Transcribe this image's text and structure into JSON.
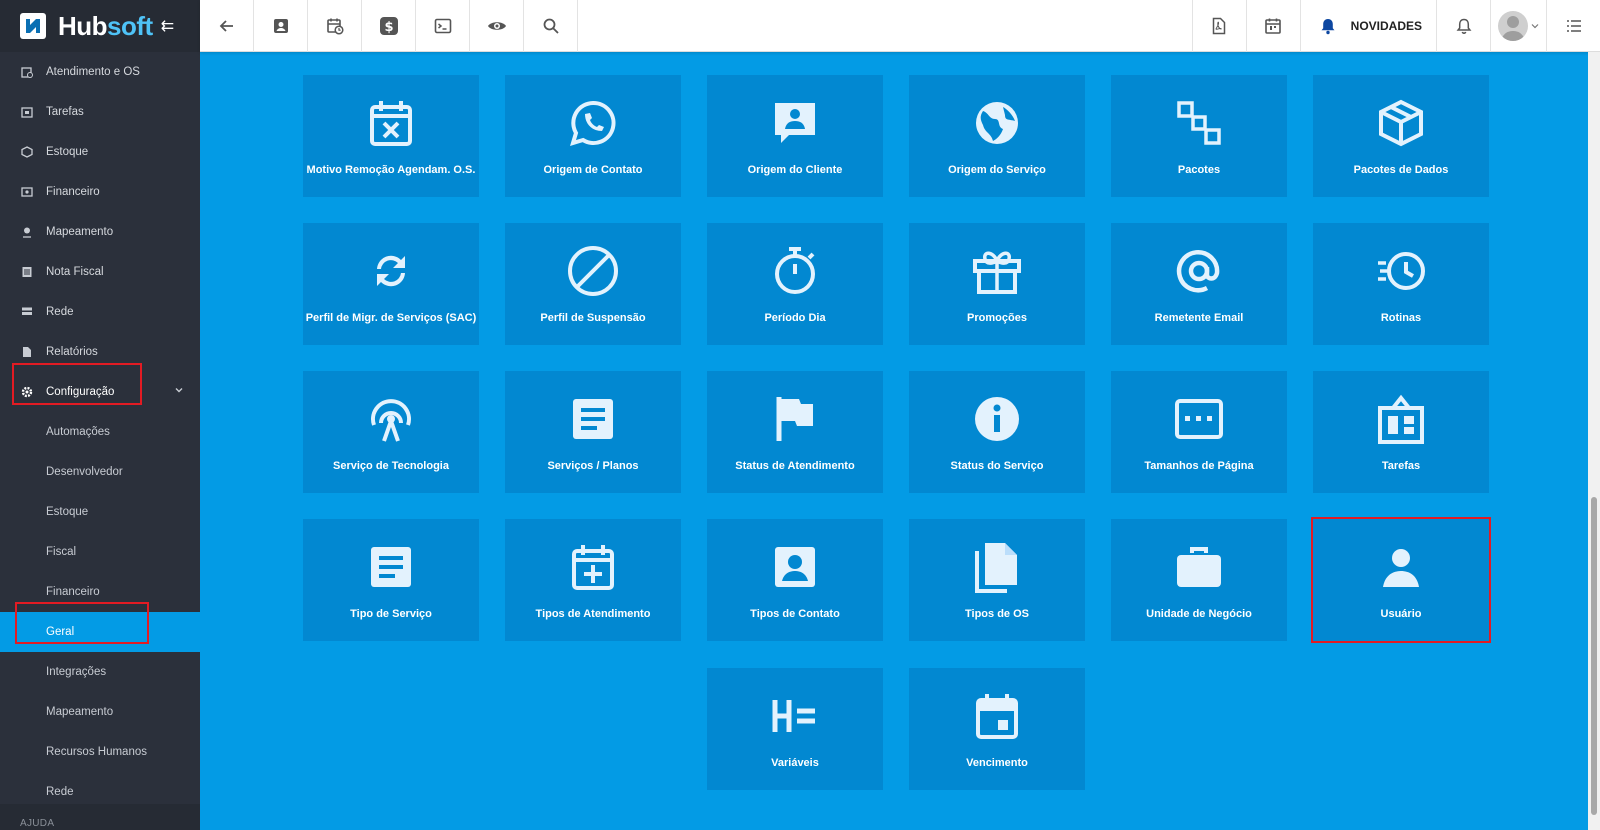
{
  "brand": {
    "part1": "Hub",
    "part2": "soft"
  },
  "colors": {
    "accent": "#039be5",
    "tile": "#0288d1",
    "sidebar": "#2b303b",
    "highlight": "#e31b23"
  },
  "sidebar": {
    "items": [
      {
        "label": "Atendimento e OS",
        "icon": "calendar-clock-icon"
      },
      {
        "label": "Tarefas",
        "icon": "building-icon"
      },
      {
        "label": "Estoque",
        "icon": "cube-icon"
      },
      {
        "label": "Financeiro",
        "icon": "money-icon"
      },
      {
        "label": "Mapeamento",
        "icon": "map-pin-icon"
      },
      {
        "label": "Nota Fiscal",
        "icon": "document-icon"
      },
      {
        "label": "Rede",
        "icon": "server-icon"
      },
      {
        "label": "Relatórios",
        "icon": "report-icon"
      },
      {
        "label": "Configuração",
        "icon": "gear-icon"
      }
    ],
    "submenu": [
      "Automações",
      "Desenvolvedor",
      "Estoque",
      "Fiscal",
      "Financeiro",
      "Geral",
      "Integrações",
      "Mapeamento",
      "Recursos Humanos",
      "Rede"
    ],
    "active_sub": "Geral",
    "section": "AJUDA"
  },
  "topbar": {
    "news_label": "NOVIDADES",
    "left_icons": [
      "back-arrow-icon",
      "contact-card-icon",
      "calendar-clock-icon",
      "dollar-icon",
      "terminal-icon",
      "eye-icon",
      "search-icon"
    ],
    "right_icons": [
      "pdf-icon",
      "calendar-building-icon",
      "bell-news-icon",
      "bell-icon",
      "avatar",
      "menu-list-icon"
    ]
  },
  "tiles": [
    {
      "label": "Motivo Remoção Agendam. O.S.",
      "icon": "calendar-x-icon"
    },
    {
      "label": "Origem de Contato",
      "icon": "whatsapp-icon"
    },
    {
      "label": "Origem do Cliente",
      "icon": "chat-person-icon"
    },
    {
      "label": "Origem do Serviço",
      "icon": "globe-icon"
    },
    {
      "label": "Pacotes",
      "icon": "squares-icon"
    },
    {
      "label": "Pacotes de Dados",
      "icon": "box-icon"
    },
    {
      "label": "Perfil de Migr. de Serviços (SAC)",
      "icon": "sync-icon"
    },
    {
      "label": "Perfil de Suspensão",
      "icon": "block-icon"
    },
    {
      "label": "Período Dia",
      "icon": "stopwatch-icon"
    },
    {
      "label": "Promoções",
      "icon": "gift-icon"
    },
    {
      "label": "Remetente Email",
      "icon": "at-icon"
    },
    {
      "label": "Rotinas",
      "icon": "history-icon"
    },
    {
      "label": "Serviço de Tecnologia",
      "icon": "antenna-icon"
    },
    {
      "label": "Serviços / Planos",
      "icon": "article-icon"
    },
    {
      "label": "Status de Atendimento",
      "icon": "flag-icon"
    },
    {
      "label": "Status do Serviço",
      "icon": "info-icon"
    },
    {
      "label": "Tamanhos de Página",
      "icon": "dots-frame-icon"
    },
    {
      "label": "Tarefas",
      "icon": "dashboard-box-icon"
    },
    {
      "label": "Tipo de Serviço",
      "icon": "article-icon"
    },
    {
      "label": "Tipos de Atendimento",
      "icon": "calendar-plus-icon"
    },
    {
      "label": "Tipos de Contato",
      "icon": "contact-box-icon"
    },
    {
      "label": "Tipos de OS",
      "icon": "files-icon"
    },
    {
      "label": "Unidade de Negócio",
      "icon": "briefcase-icon"
    },
    {
      "label": "Usuário",
      "icon": "user-icon"
    },
    {
      "label": "Variáveis",
      "icon": "variable-icon"
    },
    {
      "label": "Vencimento",
      "icon": "calendar-day-icon"
    }
  ]
}
